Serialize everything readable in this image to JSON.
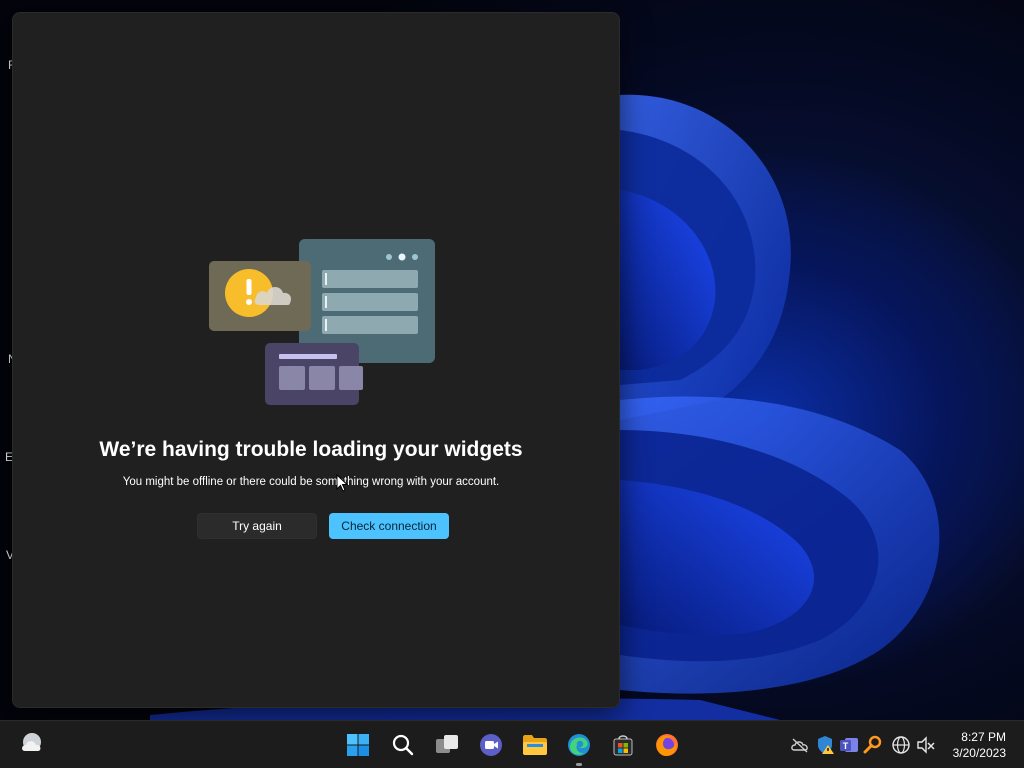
{
  "desktop": {
    "edge_labels": [
      "R",
      "N",
      "E",
      "V"
    ]
  },
  "widgets_panel": {
    "error_title": "We’re having trouble loading your widgets",
    "error_subtitle": "You might be offline or there could be something wrong with your account.",
    "try_again_label": "Try again",
    "check_connection_label": "Check connection"
  },
  "taskbar": {
    "weather_icon": "weather-cloud-icon",
    "pinned": [
      {
        "name": "start-button",
        "icon": "windows-logo-icon"
      },
      {
        "name": "search-button",
        "icon": "search-icon"
      },
      {
        "name": "task-view-button",
        "icon": "task-view-icon"
      },
      {
        "name": "teams-chat-button",
        "icon": "video-chat-icon"
      },
      {
        "name": "file-explorer-button",
        "icon": "folder-icon"
      },
      {
        "name": "edge-button",
        "icon": "edge-browser-icon"
      },
      {
        "name": "store-button",
        "icon": "store-bag-icon"
      },
      {
        "name": "firefox-button",
        "icon": "firefox-icon"
      }
    ],
    "tray": [
      "cloud-offline-icon",
      "security-warning-icon",
      "teams-icon",
      "search-key-icon",
      "network-globe-icon",
      "volume-muted-icon"
    ],
    "clock": {
      "time": "8:27 PM",
      "date": "3/20/2023"
    }
  },
  "colors": {
    "panel_bg": "#202020",
    "accent_button": "#4cc2ff",
    "taskbar_bg": "#1c1c1c"
  }
}
